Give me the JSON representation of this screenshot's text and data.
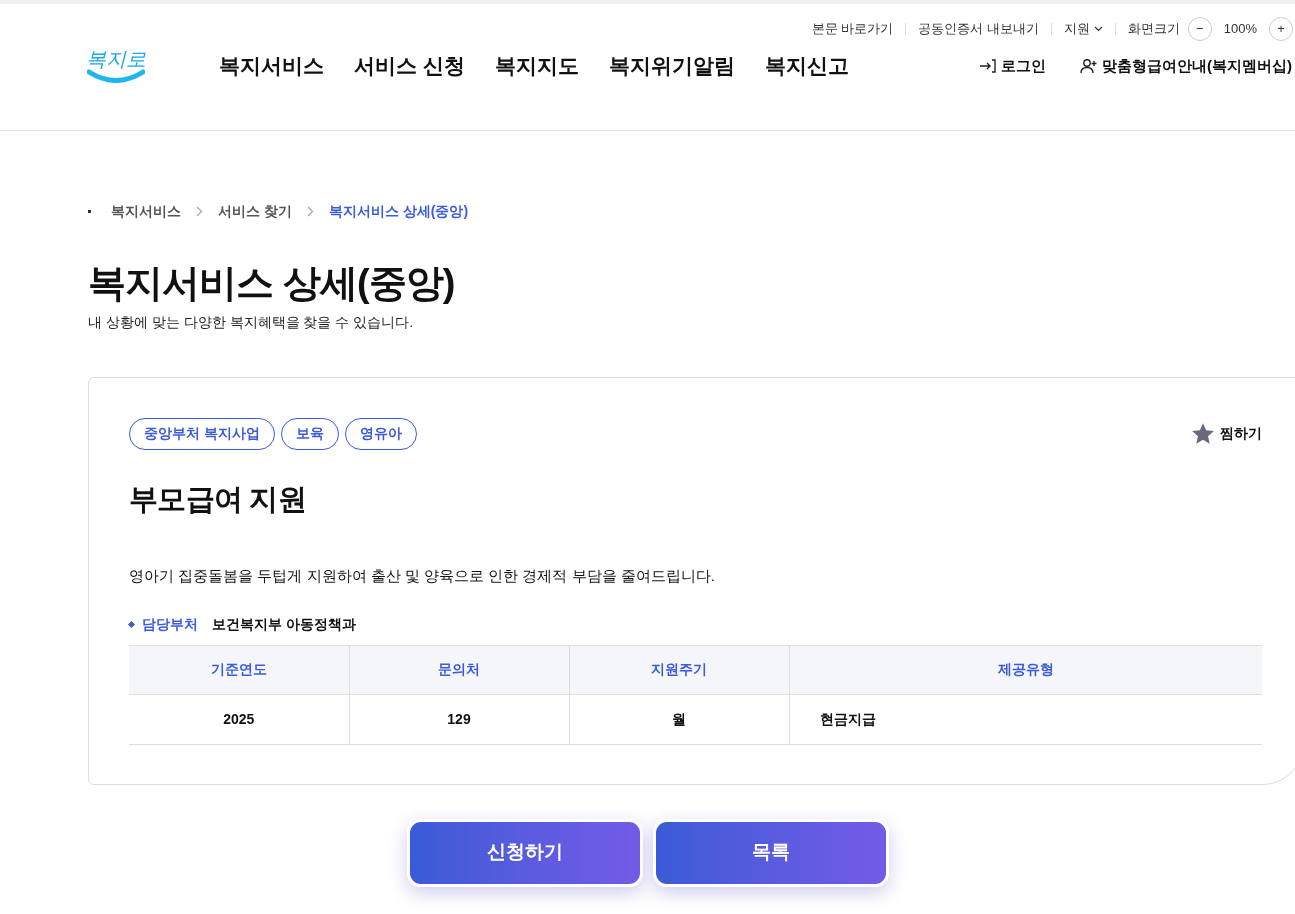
{
  "utility_bar": {
    "links": [
      "본문 바로가기",
      "공동인증서 내보내기"
    ],
    "support": "지원",
    "zoom_label": "화면크기",
    "zoom_minus": "−",
    "zoom_value": "100%",
    "zoom_plus": "+"
  },
  "header": {
    "logo": "복지로",
    "nav": [
      "복지서비스",
      "서비스 신청",
      "복지지도",
      "복지위기알림",
      "복지신고"
    ],
    "login": "로그인",
    "membership": "맞춤형급여안내(복지멤버십)"
  },
  "breadcrumb": [
    {
      "label": "복지서비스",
      "current": false
    },
    {
      "label": "서비스 찾기",
      "current": false
    },
    {
      "label": "복지서비스 상세(중앙)",
      "current": true
    }
  ],
  "page": {
    "title": "복지서비스 상세(중앙)",
    "subtitle": "내 상황에 맞는 다양한 복지혜택을 찾을 수 있습니다."
  },
  "service": {
    "tags": [
      "중앙부처 복지사업",
      "보육",
      "영유아"
    ],
    "favorite": {
      "label": "찜하기",
      "selected": false
    },
    "title": "부모급여 지원",
    "description": "영아기 집중돌봄을 두텁게 지원하여 출산 및 양육으로 인한 경제적 부담을 줄여드립니다.",
    "department_label": "담당부처",
    "department": "보건복지부 아동정책과",
    "table": {
      "columns": [
        "기준연도",
        "문의처",
        "지원주기",
        "제공유형"
      ],
      "rows": [
        [
          "2025",
          "129",
          "월",
          "현금지급"
        ]
      ]
    }
  },
  "buttons": [
    "신청하기",
    "목록"
  ]
}
